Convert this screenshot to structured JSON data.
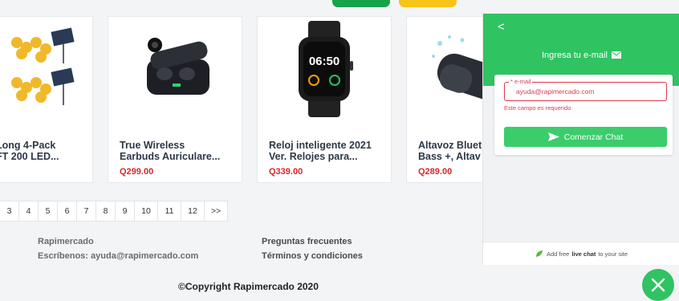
{
  "products": [
    {
      "title_line1": "Long 4-Pack",
      "title_line2": "FT 200 LED...",
      "price": "",
      "image_icon": "solar-string-lights-image"
    },
    {
      "title_line1": "True Wireless",
      "title_line2": "Earbuds Auriculare...",
      "price": "Q299.00",
      "image_icon": "earbuds-image"
    },
    {
      "title_line1": "Reloj inteligente 2021",
      "title_line2": "Ver. Relojes para...",
      "price": "Q339.00",
      "image_icon": "smartwatch-image",
      "watch_time": "06:50"
    },
    {
      "title_line1": "Altavoz Bluet",
      "title_line2": "Bass +, Altav",
      "price": "Q289.00",
      "image_icon": "bluetooth-speaker-image"
    }
  ],
  "pagination": [
    "3",
    "4",
    "5",
    "6",
    "7",
    "8",
    "9",
    "10",
    "11",
    "12",
    ">>"
  ],
  "footer": {
    "brand": "Rapimercado",
    "contact": "Escríbenos: ayuda@rapimercado.com",
    "faq": "Preguntas frecuentes",
    "terms": "Términos y condiciones",
    "copyright": "©Copyright Rapimercado 2020"
  },
  "chat": {
    "back": "<",
    "title": "Ingresa tu e-mail",
    "email_label": "* e-mail",
    "email_value": "ayuda@rapimercado.com",
    "error": "Este campo es requerido",
    "start_button": "Comenzar Chat",
    "powered_prefix": "Add free",
    "powered_bold": "live chat",
    "powered_suffix": "to your site"
  },
  "colors": {
    "accent": "#2fc362",
    "error": "#e0394a",
    "price": "#dc2626"
  }
}
